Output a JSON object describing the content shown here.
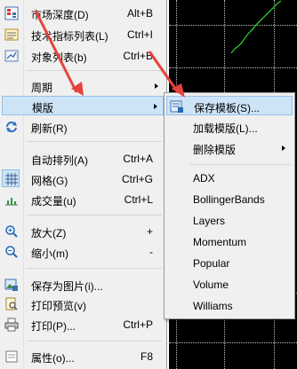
{
  "menu": {
    "items": [
      {
        "label": "市场深度(D)",
        "shortcut": "Alt+B",
        "icon": "market-depth-icon"
      },
      {
        "label": "技术指标列表(L)",
        "shortcut": "Ctrl+I",
        "icon": "indicator-list-icon"
      },
      {
        "label": "对象列表(b)",
        "shortcut": "Ctrl+B",
        "icon": "object-list-icon"
      },
      {
        "label": "周期",
        "shortcut": ""
      },
      {
        "label": "模版",
        "shortcut": ""
      },
      {
        "label": "刷新(R)",
        "shortcut": "",
        "icon": "refresh-icon"
      },
      {
        "label": "自动排列(A)",
        "shortcut": "Ctrl+A"
      },
      {
        "label": "网格(G)",
        "shortcut": "Ctrl+G",
        "icon": "grid-icon"
      },
      {
        "label": "成交量(u)",
        "shortcut": "Ctrl+L",
        "icon": "volume-icon"
      },
      {
        "label": "放大(Z)",
        "shortcut": "+",
        "icon": "zoom-in-icon"
      },
      {
        "label": "缩小(m)",
        "shortcut": "-",
        "icon": "zoom-out-icon"
      },
      {
        "label": "保存为图片(i)...",
        "shortcut": "",
        "icon": "save-picture-icon"
      },
      {
        "label": "打印预览(v)",
        "shortcut": "",
        "icon": "print-preview-icon"
      },
      {
        "label": "打印(P)...",
        "shortcut": "Ctrl+P",
        "icon": "print-icon"
      },
      {
        "label": "属性(o)...",
        "shortcut": "F8",
        "icon": "properties-icon"
      }
    ]
  },
  "submenu": {
    "actions": [
      {
        "label": "保存模板(S)...",
        "icon": "save-template-icon"
      },
      {
        "label": "加载模版(L)..."
      },
      {
        "label": "删除模版"
      }
    ],
    "templates": [
      "ADX",
      "BollingerBands",
      "Layers",
      "Momentum",
      "Popular",
      "Volume",
      "Williams"
    ]
  },
  "colors": {
    "highlight": "#cde4f7",
    "arrow": "#e8413c",
    "chart_line": "#33ff33"
  }
}
